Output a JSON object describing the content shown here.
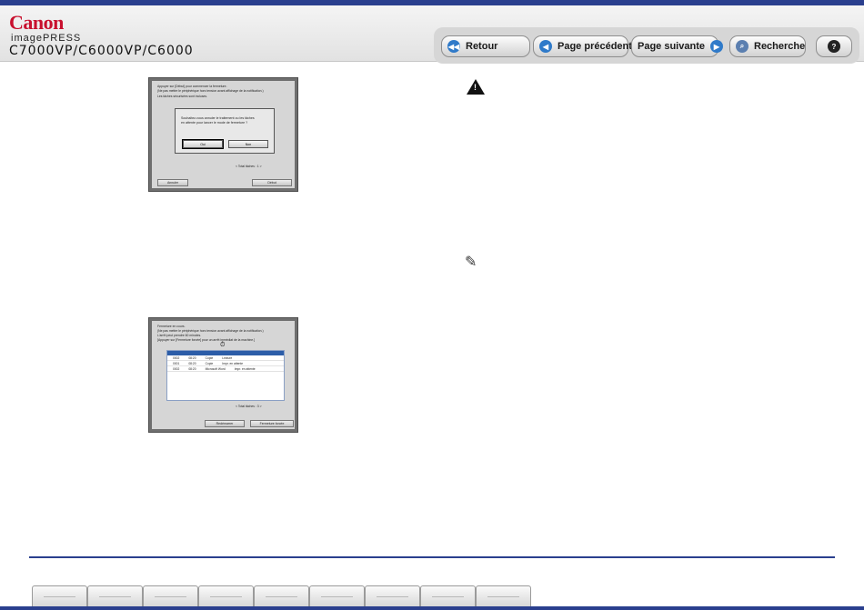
{
  "header": {
    "brand": "Canon",
    "product_line": "imagePRESS",
    "model": "C7000VP/C6000VP/C6000"
  },
  "nav": {
    "back": "Retour",
    "previous": "Page précédente",
    "next": "Page suivante",
    "search": "Recherche",
    "help": "?"
  },
  "screenshot1": {
    "line1": "Appuyer sur [Début] pour commencer la fermeture.",
    "line2": "(Ne pas mettre le périphérique hors tension avant affichage de la notification.)",
    "line3": "Les tâches sécurisées sont incluses.",
    "dialog_line1": "Souhaitez-vous annuler le traitement ou les tâches",
    "dialog_line2": "en attente pour lancer le mode de fermeture ?",
    "yes": "Oui",
    "no": "Non",
    "total": "< Total tâches : 1 >",
    "cancel": "Annuler",
    "start": "Début"
  },
  "screenshot2": {
    "line1": "Fermeture en cours.",
    "line2": "(Ne pas mettre le périphérique hors tension avant affichage de la notification.)",
    "line3": "L'arrêt peut prendre 60 minutes.",
    "line4": "[Appuyer sur [Fermeture forcée] pour un arrêt immédiat de la machine.]",
    "rows": [
      {
        "no": "0002",
        "time": "08:20",
        "name": "Copie",
        "status": "Lecture"
      },
      {
        "no": "0001",
        "time": "08:20",
        "name": "Copie",
        "status": "Impr. en attente"
      },
      {
        "no": "0002",
        "time": "08:20",
        "name": "Microsoft Word",
        "status": "Impr. en attente"
      }
    ],
    "total": "< Total tâches : 3 >",
    "restart": "Redémarrer",
    "force": "Fermeture forcée"
  },
  "colors": {
    "brand_red": "#c8102e",
    "bar_blue": "#2a3f8e",
    "nav_icon_blue": "#2f7ac9"
  },
  "icons": {
    "warning": "warning-icon",
    "note": "pencil-note-icon"
  }
}
